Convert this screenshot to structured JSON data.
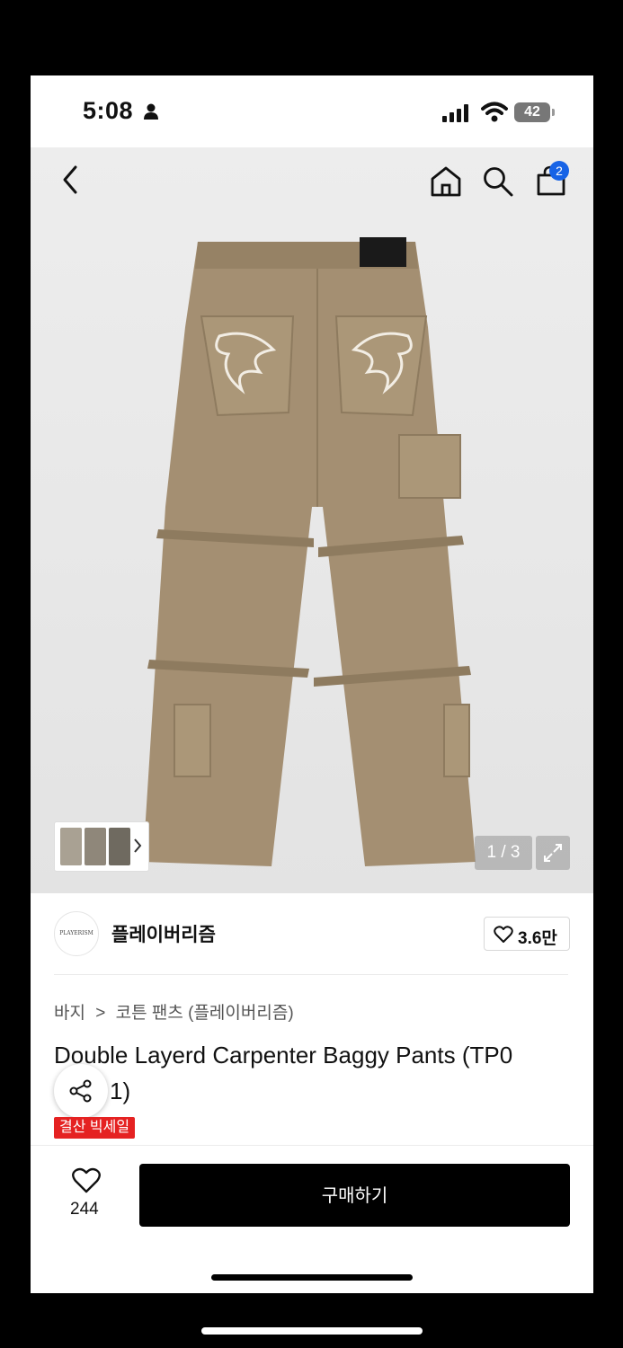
{
  "status_bar": {
    "time": "5:08",
    "battery": "42"
  },
  "nav": {
    "back_icon": "chevron-left-icon",
    "home_icon": "home-icon",
    "search_icon": "search-icon",
    "cart_icon": "shopping-bag-icon",
    "cart_badge": "2"
  },
  "gallery": {
    "counter": "1 / 3",
    "expand_icon": "expand-icon",
    "thumb_arrow_icon": "chevron-right-icon"
  },
  "brand": {
    "logo_text": "PLAYERISM",
    "name": "플레이버리즘",
    "like_count": "3.6만"
  },
  "breadcrumb": {
    "category": "바지",
    "separator": ">",
    "subcategory": "코튼 팬츠 (플레이버리즘)"
  },
  "product": {
    "title": "Double Layerd Carpenter Baggy Pants (TP0",
    "title_line2": "1)",
    "sale_badge": "결산 빅세일"
  },
  "bottom_bar": {
    "wish_count": "244",
    "buy_label": "구매하기"
  },
  "colors": {
    "accent_blue": "#1763e6",
    "sale_red": "#e52222",
    "buy_button": "#000000",
    "pants": "#a48f72"
  }
}
